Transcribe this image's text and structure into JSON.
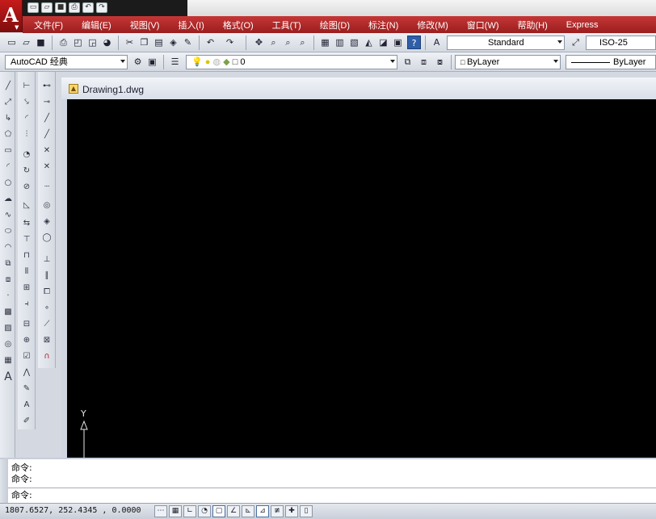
{
  "app": {
    "logo_letter": "A",
    "logo_caret": "▼"
  },
  "qat": [
    "new-icon",
    "open-icon",
    "save-icon",
    "print-icon",
    "undo-icon",
    "redo-icon"
  ],
  "menu": [
    "文件(F)",
    "编辑(E)",
    "视图(V)",
    "插入(I)",
    "格式(O)",
    "工具(T)",
    "绘图(D)",
    "标注(N)",
    "修改(M)",
    "窗口(W)",
    "帮助(H)",
    "Express"
  ],
  "toolbar1": {
    "text_style": "Standard",
    "dim_style": "ISO-25"
  },
  "toolbar2": {
    "workspace": "AutoCAD 经典",
    "layer": "0",
    "color": "ByLayer",
    "linetype": "ByLayer"
  },
  "document": {
    "tab_title": "Drawing1.dwg"
  },
  "ucs": {
    "y_label": "Y"
  },
  "command": {
    "lines": [
      "命令:",
      "命令:"
    ],
    "prompt": "命令:"
  },
  "status": {
    "coords": "1807.6527, 252.4345 , 0.0000"
  },
  "colors": {
    "accent": "#b52020",
    "canvas": "#000000"
  }
}
